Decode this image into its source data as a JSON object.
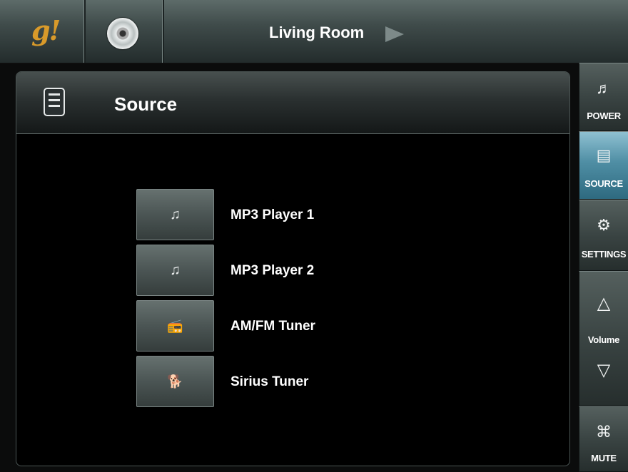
{
  "topbar": {
    "logo_text": "g!",
    "disc_icon": "disc-icon",
    "room_title": "Living Room",
    "room_arrow_icon": "play-arrow-icon"
  },
  "panel": {
    "title": "Source",
    "icon": "remote-icon"
  },
  "sources": [
    {
      "label": "MP3 Player 1",
      "icon": "music-notes-icon",
      "glyph": "♫"
    },
    {
      "label": "MP3 Player 2",
      "icon": "music-notes-icon",
      "glyph": "♫"
    },
    {
      "label": "AM/FM Tuner",
      "icon": "radio-icon",
      "glyph": "📻"
    },
    {
      "label": "Sirius Tuner",
      "icon": "sirius-dog-icon",
      "glyph": "🐕"
    }
  ],
  "sidebar": {
    "power": {
      "label": "POWER",
      "icon": "music-note-icon",
      "glyph": "♬"
    },
    "source": {
      "label": "SOURCE",
      "icon": "remote-icon",
      "glyph": "▤"
    },
    "settings": {
      "label": "SETTINGS",
      "icon": "gear-icon",
      "glyph": "⚙"
    },
    "volume": {
      "label": "Volume",
      "up_icon": "volume-up-icon",
      "up_glyph": "△",
      "down_icon": "volume-down-icon",
      "down_glyph": "▽"
    },
    "mute": {
      "label": "MUTE",
      "icon": "mute-icon",
      "glyph": "⌘"
    }
  },
  "colors": {
    "accent_active": "#4f8ea4",
    "logo": "#d99a2a"
  }
}
